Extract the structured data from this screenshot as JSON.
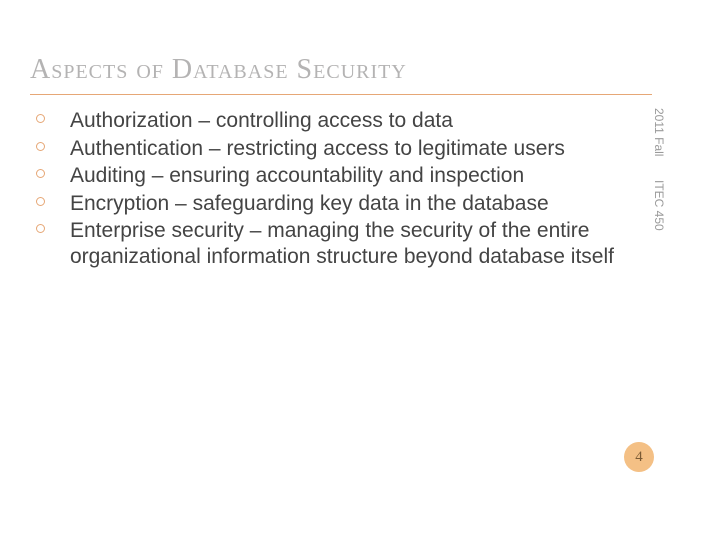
{
  "title": "Aspects of Database Security",
  "bullets": [
    "Authorization – controlling access to data",
    "Authentication – restricting access to legitimate users",
    "Auditing – ensuring accountability and inspection",
    "Encryption – safeguarding key data in the database",
    "Enterprise security – managing the security of the entire organizational information structure beyond database itself"
  ],
  "side": {
    "term": "2011 Fall",
    "course": "ITEC 450"
  },
  "page_number": "4"
}
